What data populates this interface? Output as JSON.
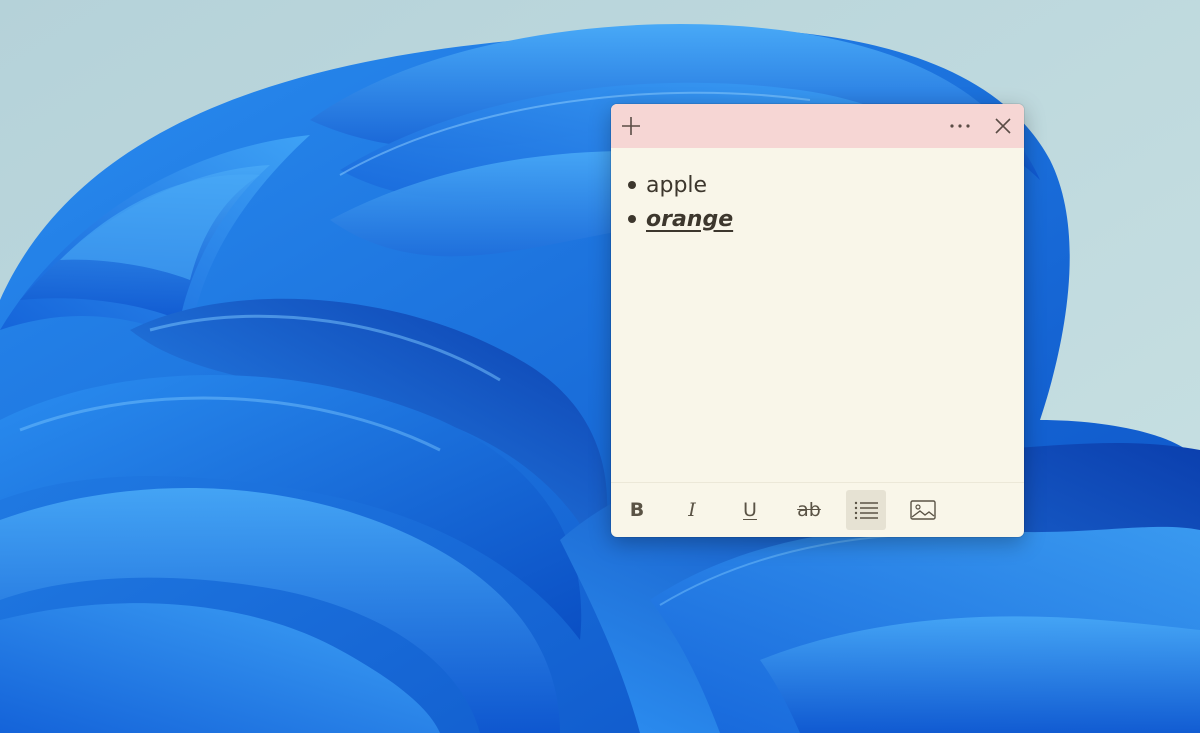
{
  "note": {
    "header_color": "#f6d6d4",
    "body_color": "#f9f6e9",
    "header": {
      "add_icon": "plus-icon",
      "menu_icon": "more-horizontal-icon",
      "close_icon": "close-icon"
    },
    "items": [
      {
        "text": "apple",
        "style": "normal"
      },
      {
        "text": "orange",
        "style": "bold-italic-underline"
      }
    ],
    "toolbar": {
      "bold_label": "B",
      "italic_label": "I",
      "underline_label": "U",
      "strikethrough_label": "ab",
      "bullets_icon": "bullet-list-icon",
      "bullets_active": true,
      "image_icon": "image-icon"
    }
  },
  "desktop": {
    "wallpaper": "Windows bloom wallpaper",
    "accent": "#1f7be8"
  }
}
